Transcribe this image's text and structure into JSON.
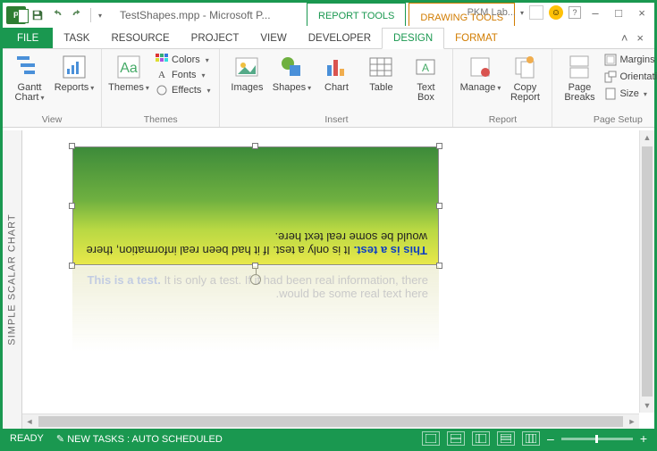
{
  "titlebar": {
    "filename": "TestShapes.mpp - Microsoft P...",
    "tool_context_report": "REPORT TOOLS",
    "tool_context_drawing": "DRAWING TOOLS",
    "pkm_label": "PKM Lab...",
    "min": "–",
    "max": "□",
    "close": "×"
  },
  "tabs": {
    "file": "FILE",
    "task": "TASK",
    "resource": "RESOURCE",
    "project": "PROJECT",
    "view": "VIEW",
    "developer": "DEVELOPER",
    "design": "DESIGN",
    "format": "FORMAT"
  },
  "ribbon": {
    "view": {
      "gantt": "Gantt Chart",
      "reports": "Reports",
      "group": "View"
    },
    "themes": {
      "themes": "Themes",
      "colors": "Colors",
      "fonts": "Fonts",
      "effects": "Effects",
      "group": "Themes"
    },
    "insert": {
      "images": "Images",
      "shapes": "Shapes",
      "chart": "Chart",
      "table": "Table",
      "textbox_l1": "Text",
      "textbox_l2": "Box",
      "group": "Insert"
    },
    "report": {
      "manage": "Manage",
      "copy_l1": "Copy",
      "copy_l2": "Report",
      "group": "Report"
    },
    "pagesetup": {
      "pagebreaks_l1": "Page",
      "pagebreaks_l2": "Breaks",
      "margins": "Margins",
      "orientation": "Orientation",
      "size": "Size",
      "group": "Page Setup"
    }
  },
  "side_tab": "SIMPLE SCALAR CHART",
  "shape": {
    "bold": "This is a test.",
    "rest": " It is only a test. If it had been real information, there would be some real text here."
  },
  "status": {
    "ready": "READY",
    "newtasks": "NEW TASKS : AUTO SCHEDULED",
    "minus": "–",
    "plus": "+"
  }
}
